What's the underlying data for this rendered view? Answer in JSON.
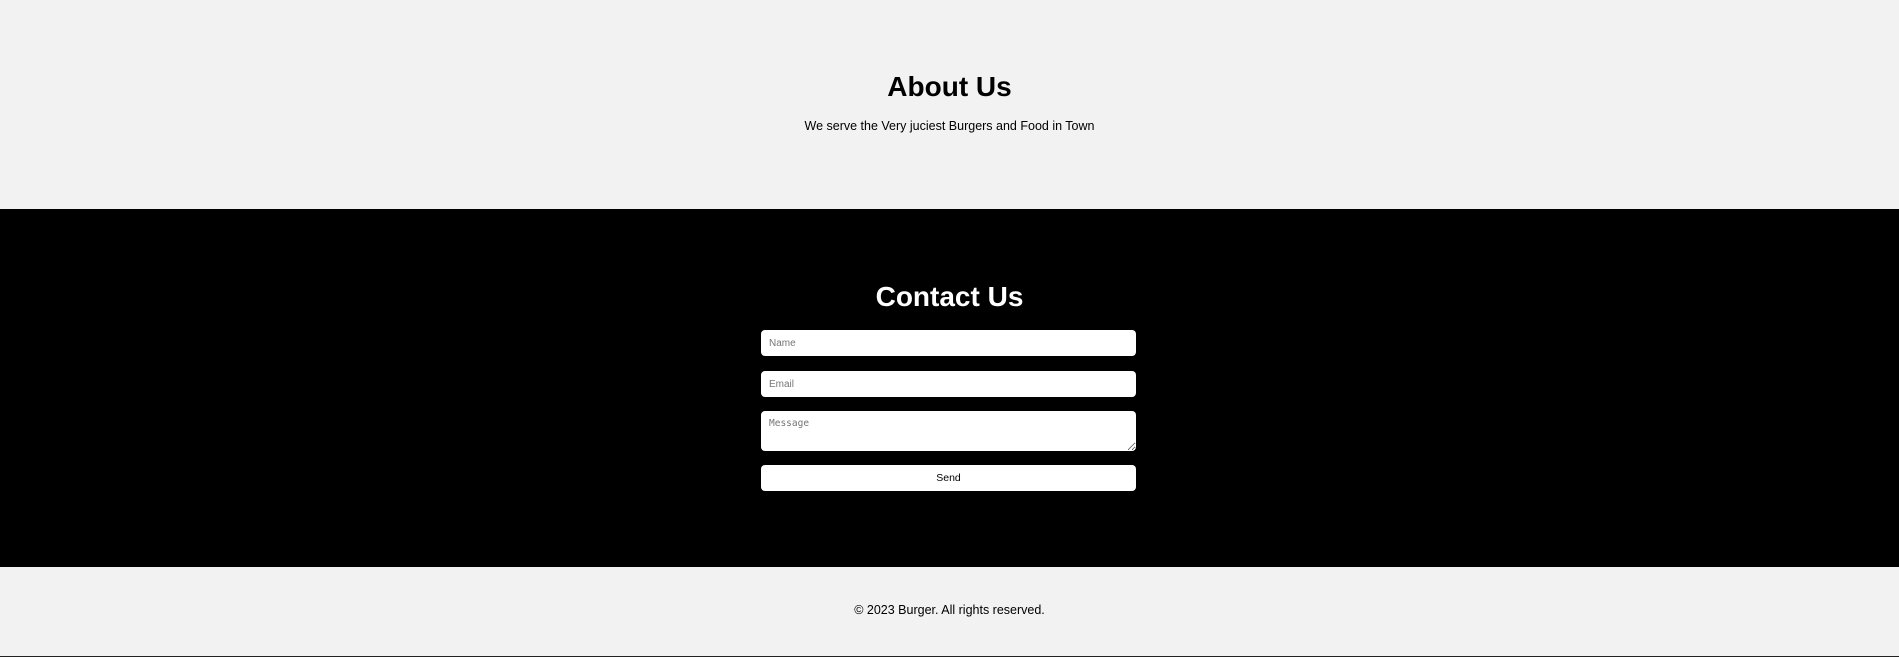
{
  "about": {
    "title": "About Us",
    "description": "We serve the Very juciest Burgers and Food in Town"
  },
  "contact": {
    "title": "Contact Us",
    "name_placeholder": "Name",
    "email_placeholder": "Email",
    "message_placeholder": "Message",
    "send_label": "Send"
  },
  "footer": {
    "copyright": "© 2023 Burger. All rights reserved."
  },
  "colors": {
    "light_background": "#f2f2f2",
    "dark_background": "#000000",
    "field_background": "#ffffff"
  }
}
